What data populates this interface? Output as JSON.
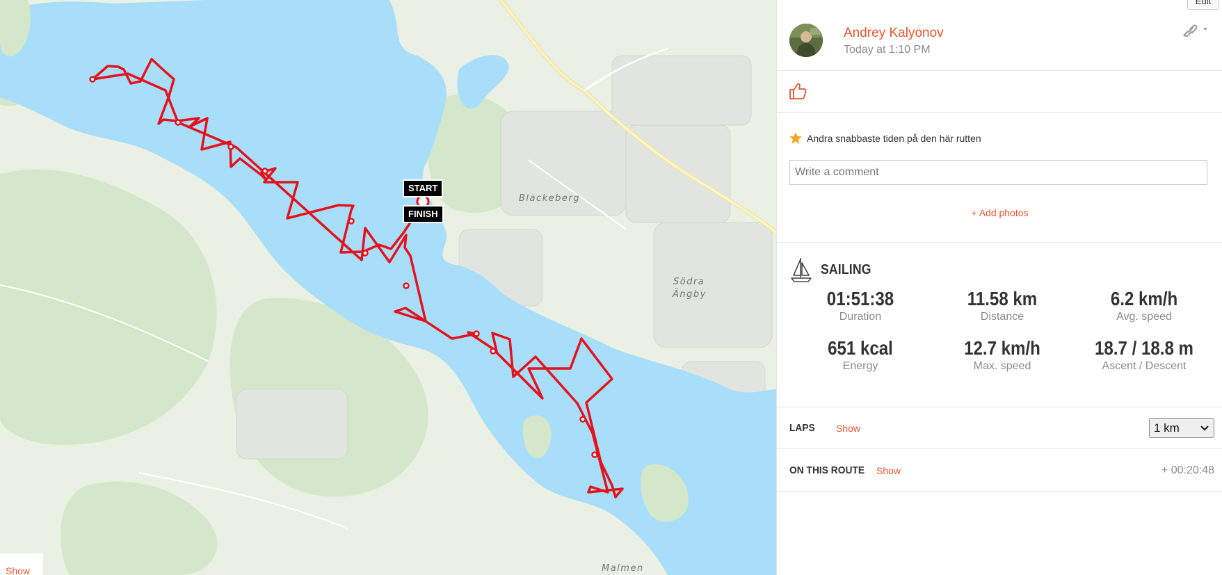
{
  "map": {
    "labels": {
      "blackeberg": "Blackeberg",
      "sodra_angby_1": "Södra",
      "sodra_angby_2": "Ängby",
      "malmen": "Malmen"
    },
    "start_label": "START",
    "finish_label": "FINISH",
    "show_label": "Show",
    "route_color": "#e3121b",
    "water_color": "#a8defa",
    "land_color": "#eaf1e4",
    "forest_color": "#d6e8cc"
  },
  "toolbar": {
    "edit_label": "Edit"
  },
  "user": {
    "name": "Andrey Kalyonov",
    "timestamp": "Today at 1:10 PM"
  },
  "icons": {
    "link": "link-icon",
    "like": "thumbs-up-icon",
    "star": "star-icon",
    "sport": "sailboat-icon"
  },
  "achievement": {
    "text": "Andra snabbaste tiden på den här rutten"
  },
  "comment": {
    "placeholder": "Write a comment"
  },
  "add_photos_label": "+ Add photos",
  "workout": {
    "sport": "SAILING",
    "stats": [
      {
        "value": "01:51:38",
        "label": "Duration"
      },
      {
        "value": "11.58 km",
        "label": "Distance"
      },
      {
        "value": "6.2 km/h",
        "label": "Avg. speed"
      },
      {
        "value": "651 kcal",
        "label": "Energy"
      },
      {
        "value": "12.7 km/h",
        "label": "Max. speed"
      },
      {
        "value": "18.7 / 18.8 m",
        "label": "Ascent / Descent"
      }
    ]
  },
  "laps": {
    "title": "LAPS",
    "show_label": "Show",
    "selected": "1 km"
  },
  "on_route": {
    "title": "ON THIS ROUTE",
    "show_label": "Show",
    "time": "+ 00:20:48"
  },
  "accent_color": "#e8552e"
}
